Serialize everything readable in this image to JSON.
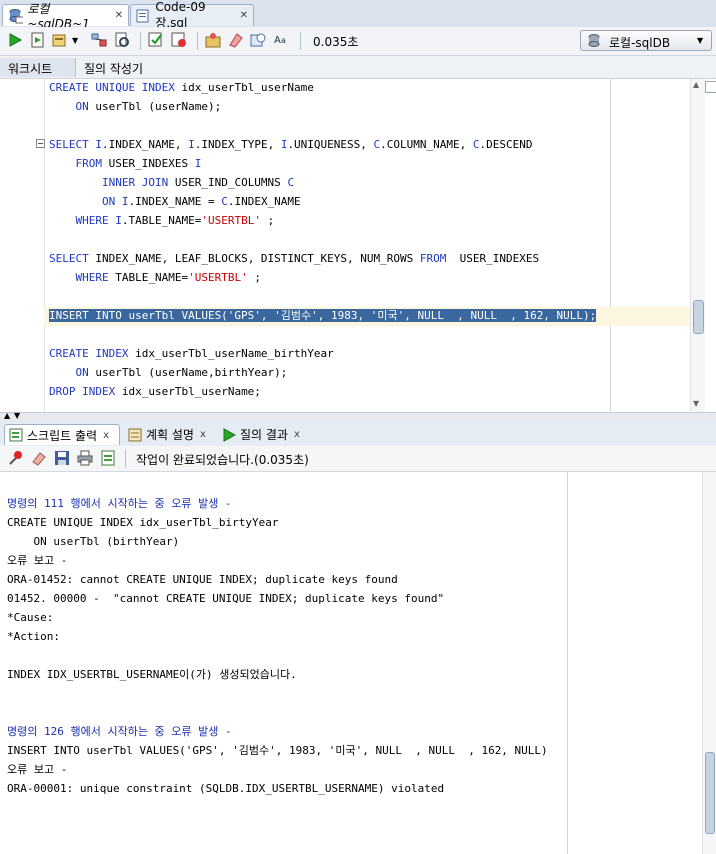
{
  "colors": {
    "keyword": "#1e37c2",
    "string": "#c80000",
    "selection": "#39679e",
    "error_header": "#1a2fb0"
  },
  "doc_tabs": [
    {
      "label": "로컬~sqlDB~1",
      "icon": "sql-worksheet-icon",
      "active": true
    },
    {
      "label": "Code-09장.sql",
      "icon": "sql-file-icon",
      "active": false
    }
  ],
  "toolbar": {
    "icons": [
      "run-statement-icon",
      "run-script-icon",
      "commit-dropdown-icon",
      "explain-plan-icon",
      "autotrace-icon",
      "commit-icon",
      "rollback-icon",
      "unshared-sql-icon",
      "clear-icon",
      "sql-history-icon",
      "format-icon"
    ],
    "timing": "0.035초",
    "connection": "로컬-sqlDB"
  },
  "subtabs": [
    "워크시트",
    "질의 작성기"
  ],
  "editor": {
    "lines": [
      [
        [
          "kw",
          "CREATE UNIQUE INDEX"
        ],
        [
          "t",
          " idx_userTbl_userName"
        ]
      ],
      [
        [
          "t",
          "    "
        ],
        [
          "kw",
          "ON"
        ],
        [
          "t",
          " userTbl (userName);"
        ]
      ],
      [],
      [
        [
          "kw",
          "SELECT"
        ],
        [
          "t",
          " "
        ],
        [
          "kw",
          "I"
        ],
        [
          "t",
          ".INDEX_NAME, "
        ],
        [
          "kw",
          "I"
        ],
        [
          "t",
          ".INDEX_TYPE, "
        ],
        [
          "kw",
          "I"
        ],
        [
          "t",
          ".UNIQUENESS, "
        ],
        [
          "kw",
          "C"
        ],
        [
          "t",
          ".COLUMN_NAME, "
        ],
        [
          "kw",
          "C"
        ],
        [
          "t",
          ".DESCEND"
        ]
      ],
      [
        [
          "t",
          "    "
        ],
        [
          "kw",
          "FROM"
        ],
        [
          "t",
          " USER_INDEXES "
        ],
        [
          "kw",
          "I"
        ]
      ],
      [
        [
          "t",
          "        "
        ],
        [
          "kw",
          "INNER JOIN"
        ],
        [
          "t",
          " USER_IND_COLUMNS "
        ],
        [
          "kw",
          "C"
        ]
      ],
      [
        [
          "t",
          "        "
        ],
        [
          "kw",
          "ON"
        ],
        [
          "t",
          " "
        ],
        [
          "kw",
          "I"
        ],
        [
          "t",
          ".INDEX_NAME = "
        ],
        [
          "kw",
          "C"
        ],
        [
          "t",
          ".INDEX_NAME"
        ]
      ],
      [
        [
          "t",
          "    "
        ],
        [
          "kw",
          "WHERE"
        ],
        [
          "t",
          " "
        ],
        [
          "kw",
          "I"
        ],
        [
          "t",
          ".TABLE_NAME="
        ],
        [
          "str",
          "'USERTBL'"
        ],
        [
          "t",
          " ;"
        ]
      ],
      [],
      [
        [
          "kw",
          "SELECT"
        ],
        [
          "t",
          " INDEX_NAME, LEAF_BLOCKS, DISTINCT_KEYS, NUM_ROWS "
        ],
        [
          "kw",
          "FROM"
        ],
        [
          "t",
          "  USER_INDEXES"
        ]
      ],
      [
        [
          "t",
          "    "
        ],
        [
          "kw",
          "WHERE"
        ],
        [
          "t",
          " TABLE_NAME="
        ],
        [
          "str",
          "'USERTBL'"
        ],
        [
          "t",
          " ;"
        ]
      ],
      [],
      [
        [
          "sel",
          "INSERT INTO userTbl VALUES('GPS', '김범수', 1983, '미국', NULL  , NULL  , 162, NULL);"
        ]
      ],
      [],
      [
        [
          "kw",
          "CREATE INDEX"
        ],
        [
          "t",
          " idx_userTbl_userName_birthYear"
        ]
      ],
      [
        [
          "t",
          "    "
        ],
        [
          "kw",
          "ON"
        ],
        [
          "t",
          " userTbl (userName,birthYear);"
        ]
      ],
      [
        [
          "kw",
          "DROP INDEX"
        ],
        [
          "t",
          " idx_userTbl_userName;"
        ]
      ]
    ]
  },
  "output_tabs": [
    {
      "label": "스크립트 출력",
      "icon": "script-output-icon",
      "active": true
    },
    {
      "label": "계획 설명",
      "icon": "explain-plan-icon",
      "active": false
    },
    {
      "label": "질의 결과",
      "icon": "query-result-icon",
      "active": false
    }
  ],
  "output_toolbar": {
    "icons": [
      "pin-icon",
      "eraser-icon",
      "save-icon",
      "print-icon",
      "document-icon"
    ],
    "status": "작업이 완료되었습니다.(0.035초)"
  },
  "output": {
    "lines": [
      {
        "style": "plain",
        "text": ""
      },
      {
        "style": "blue",
        "text": "명령의 111 행에서 시작하는 중 오류 발생 -"
      },
      {
        "style": "plain",
        "text": "CREATE UNIQUE INDEX idx_userTbl_birtyYear"
      },
      {
        "style": "plain",
        "text": "    ON userTbl (birthYear)"
      },
      {
        "style": "plain",
        "text": "오류 보고 -"
      },
      {
        "style": "plain",
        "text": "ORA-01452: cannot CREATE UNIQUE INDEX; duplicate keys found"
      },
      {
        "style": "plain",
        "text": "01452. 00000 -  \"cannot CREATE UNIQUE INDEX; duplicate keys found\""
      },
      {
        "style": "plain",
        "text": "*Cause:"
      },
      {
        "style": "plain",
        "text": "*Action:"
      },
      {
        "style": "plain",
        "text": ""
      },
      {
        "style": "plain",
        "text": "INDEX IDX_USERTBL_USERNAME이(가) 생성되었습니다."
      },
      {
        "style": "plain",
        "text": ""
      },
      {
        "style": "plain",
        "text": ""
      },
      {
        "style": "blue",
        "text": "명령의 126 행에서 시작하는 중 오류 발생 -"
      },
      {
        "style": "plain",
        "text": "INSERT INTO userTbl VALUES('GPS', '김범수', 1983, '미국', NULL  , NULL  , 162, NULL)"
      },
      {
        "style": "plain",
        "text": "오류 보고 -"
      },
      {
        "style": "plain",
        "text": "ORA-00001: unique constraint (SQLDB.IDX_USERTBL_USERNAME) violated"
      }
    ]
  }
}
